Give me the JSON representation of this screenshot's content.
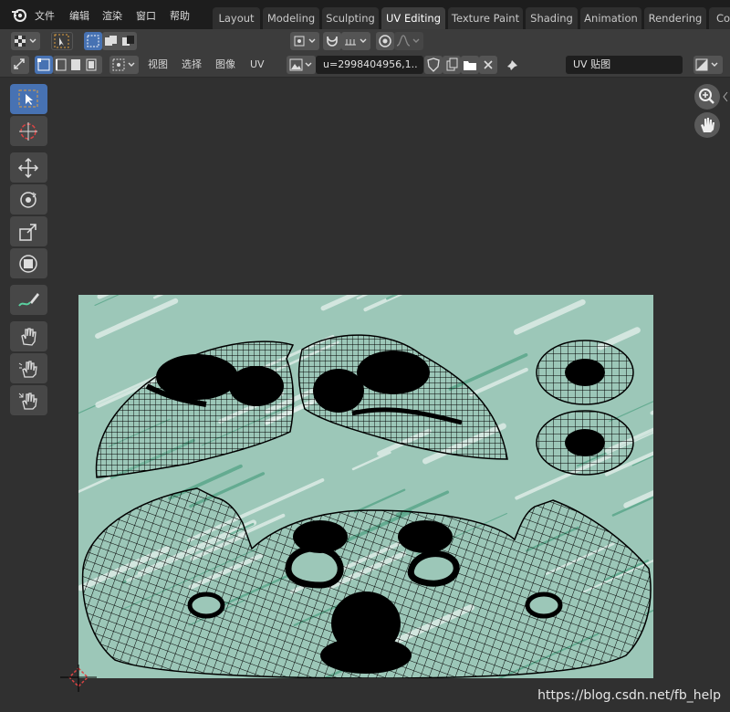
{
  "menu": [
    "文件",
    "编辑",
    "渲染",
    "窗口",
    "帮助"
  ],
  "workspace_tabs": [
    {
      "label": "Layout",
      "active": false
    },
    {
      "label": "Modeling",
      "active": false
    },
    {
      "label": "Sculpting",
      "active": false
    },
    {
      "label": "UV Editing",
      "active": true
    },
    {
      "label": "Texture Paint",
      "active": false
    },
    {
      "label": "Shading",
      "active": false
    },
    {
      "label": "Animation",
      "active": false
    },
    {
      "label": "Rendering",
      "active": false
    },
    {
      "label": "Co",
      "active": false
    }
  ],
  "header2": {
    "menus": [
      "视图",
      "选择",
      "图像",
      "UV"
    ],
    "image_name": "u=2998404956,1..",
    "uv_map_name": "UV 贴图"
  },
  "toolbar": {
    "tools": [
      "select-box",
      "cursor",
      "move",
      "rotate",
      "scale",
      "transform",
      "annotate",
      "grab",
      "relax",
      "pinch"
    ],
    "active_tool": "select-box"
  },
  "colors": {
    "active_blue": "#4772b3",
    "texture_green": "#8fbfb0"
  },
  "watermark": "https://blog.csdn.net/fb_help"
}
